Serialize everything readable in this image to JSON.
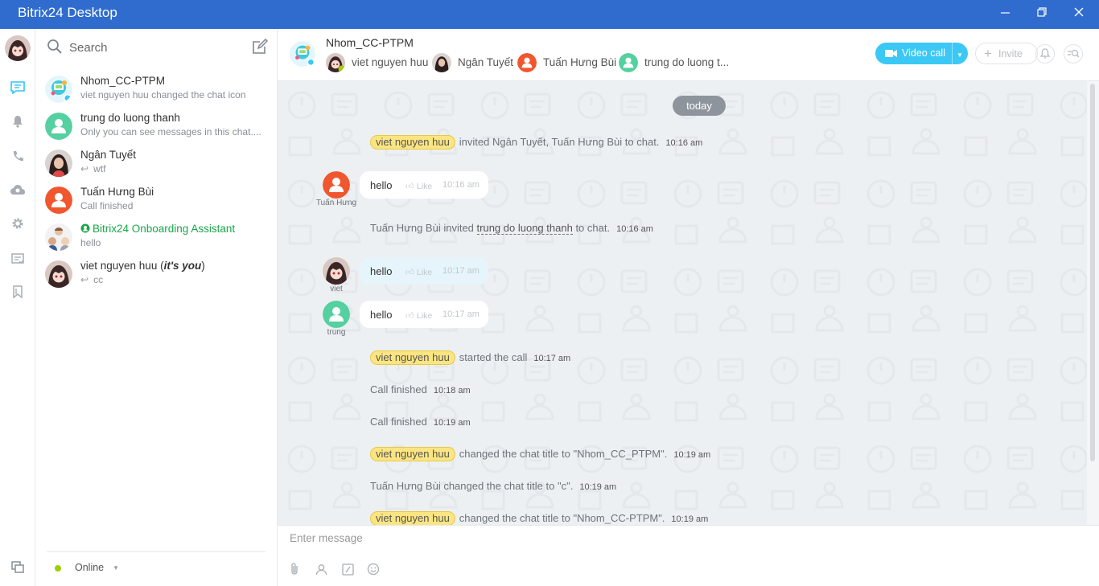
{
  "window": {
    "title": "Bitrix24 Desktop"
  },
  "rail": {
    "items": [
      "chat-icon",
      "bell-icon",
      "phone-icon",
      "cloud-icon",
      "gear-icon",
      "tasks-icon",
      "bookmark-icon",
      "windows-icon"
    ]
  },
  "recent": {
    "search_placeholder": "Search",
    "items": [
      {
        "name": "Nhom_CC-PTPM",
        "sub": "viet nguyen huu changed the chat icon"
      },
      {
        "name": "trung do luong thanh",
        "sub": "Only you can see messages in this chat...."
      },
      {
        "name": "Ngân Tuyết",
        "sub": "wtf"
      },
      {
        "name": "Tuấn Hưng Bùi",
        "sub": "Call finished"
      },
      {
        "name": "Bitrix24 Onboarding Assistant",
        "sub": "hello"
      },
      {
        "name": "viet nguyen huu",
        "name_suffix": "it's you",
        "sub": "cc"
      }
    ],
    "status": "Online"
  },
  "chat": {
    "title": "Nhom_CC-PTPM",
    "members": [
      "viet nguyen huu",
      "Ngân Tuyết",
      "Tuấn Hưng Bùi",
      "trung do luong t..."
    ],
    "video_call": "Video call",
    "invite": "Invite",
    "date_divider": "today",
    "system1": {
      "tag": "viet nguyen huu",
      "text": "invited Ngân Tuyết, Tuấn Hưng Bùi to chat.",
      "time": "10:16 am"
    },
    "msg1": {
      "author": "Tuấn Hưng",
      "text": "hello",
      "like": "Like",
      "time": "10:16 am"
    },
    "system2": {
      "text_before": "Tuấn Hưng Bùi invited",
      "link": "trung do luong thanh",
      "text_after": "to chat.",
      "time": "10:16 am"
    },
    "msg2": {
      "author": "viet",
      "text": "hello",
      "like": "Like",
      "time": "10:17 am"
    },
    "msg3": {
      "author": "trung",
      "text": "hello",
      "like": "Like",
      "time": "10:17 am"
    },
    "system3": {
      "tag": "viet nguyen huu",
      "text": "started the call",
      "time": "10:17 am"
    },
    "system4": {
      "text": "Call finished",
      "time": "10:18 am"
    },
    "system5": {
      "text": "Call finished",
      "time": "10:19 am"
    },
    "system6": {
      "tag": "viet nguyen huu",
      "text": "changed the chat title to \"Nhom_CC_PTPM\".",
      "time": "10:19 am"
    },
    "system7": {
      "text": "Tuấn Hưng Bùi changed the chat title to \"c\".",
      "time": "10:19 am"
    },
    "system8": {
      "tag": "viet nguyen huu",
      "text": "changed the chat title to \"Nhom_CC-PTPM\".",
      "time": "10:19 am"
    },
    "composer_placeholder": "Enter message"
  },
  "colors": {
    "titlebar": "#2f6cce",
    "accent": "#3bc8f5",
    "online": "#9dcf00",
    "tag_bg": "#fbe580",
    "avatar_green": "#55d0a0",
    "avatar_orange": "#f0572f",
    "onboarding_green": "#1aa64a"
  }
}
